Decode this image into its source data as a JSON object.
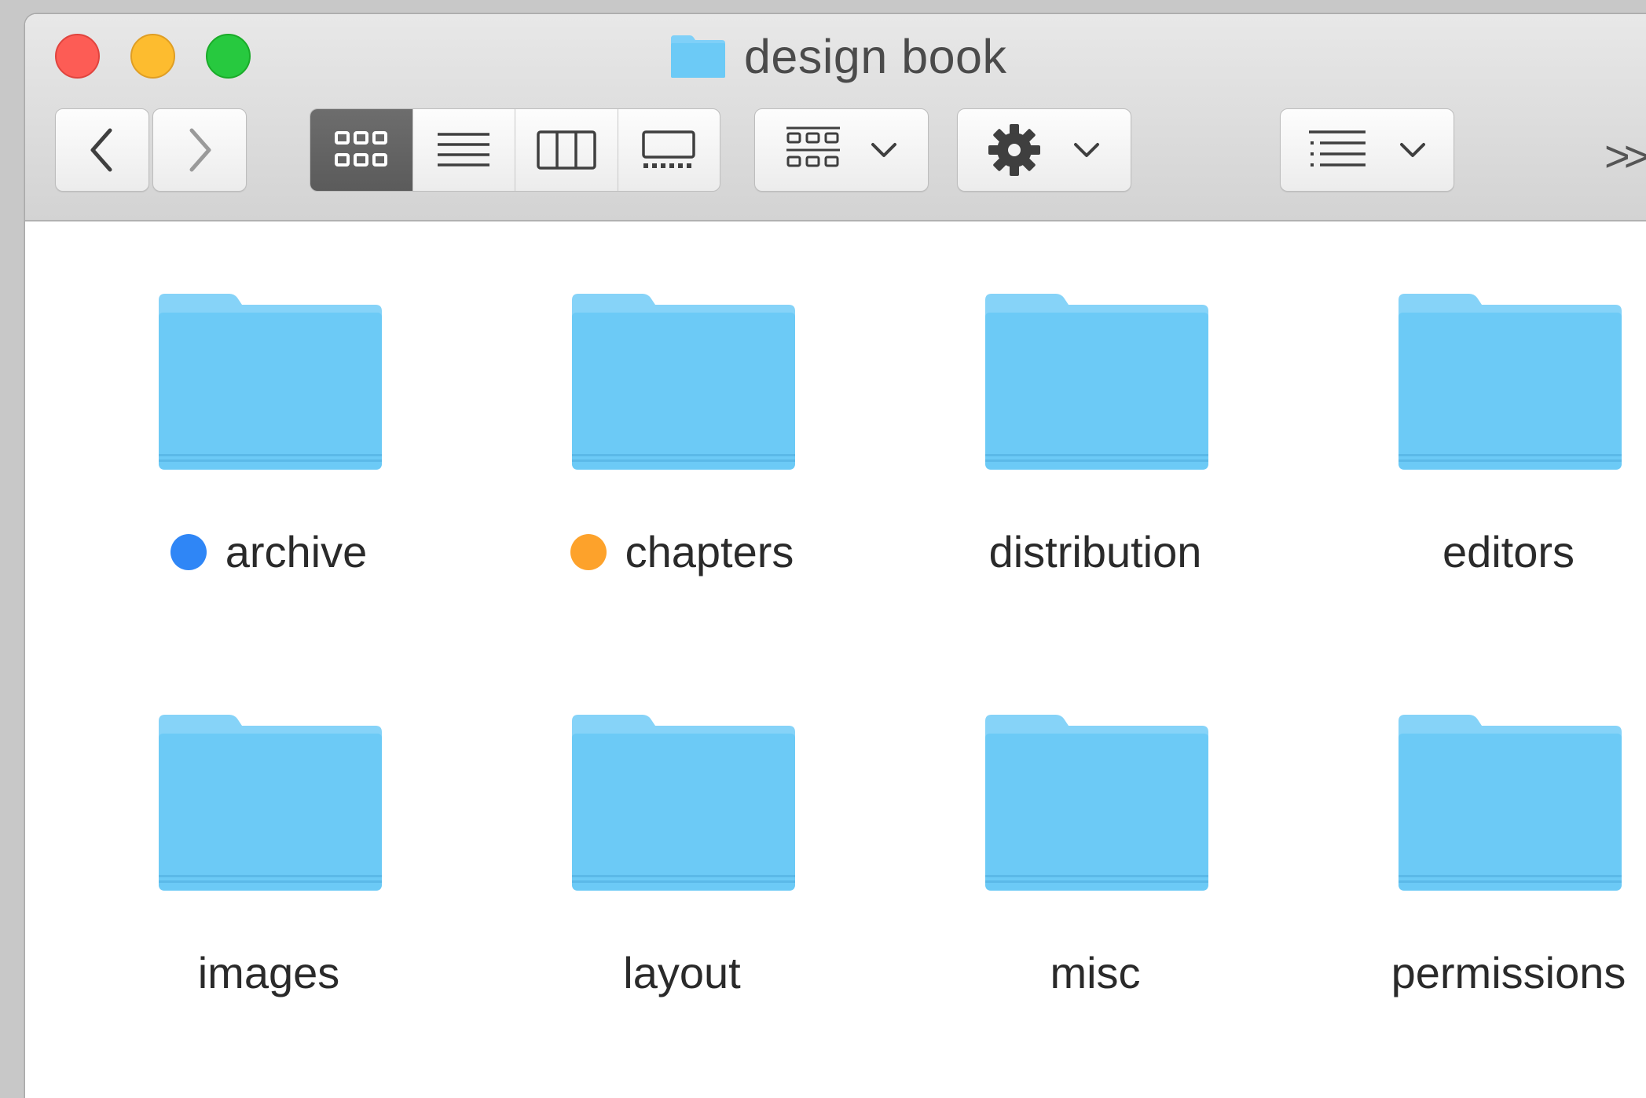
{
  "window": {
    "title": "design book"
  },
  "toolbar": {
    "back_icon": "chevron-left-icon",
    "forward_icon": "chevron-right-icon",
    "view_modes": [
      "icon-view",
      "list-view",
      "column-view",
      "gallery-view"
    ],
    "active_view": "icon-view",
    "group_icon": "group-grid-icon",
    "action_icon": "gear-icon",
    "arrange_icon": "arrange-list-icon",
    "overflow_label": ">>"
  },
  "colors": {
    "tag_blue": "#2f86f6",
    "tag_orange": "#fda22b",
    "folder": "#6ccaf6"
  },
  "items": [
    {
      "name": "archive",
      "tag": "blue"
    },
    {
      "name": "chapters",
      "tag": "orange"
    },
    {
      "name": "distribution",
      "tag": ""
    },
    {
      "name": "editors",
      "tag": ""
    },
    {
      "name": "images",
      "tag": ""
    },
    {
      "name": "layout",
      "tag": ""
    },
    {
      "name": "misc",
      "tag": ""
    },
    {
      "name": "permissions",
      "tag": ""
    }
  ]
}
